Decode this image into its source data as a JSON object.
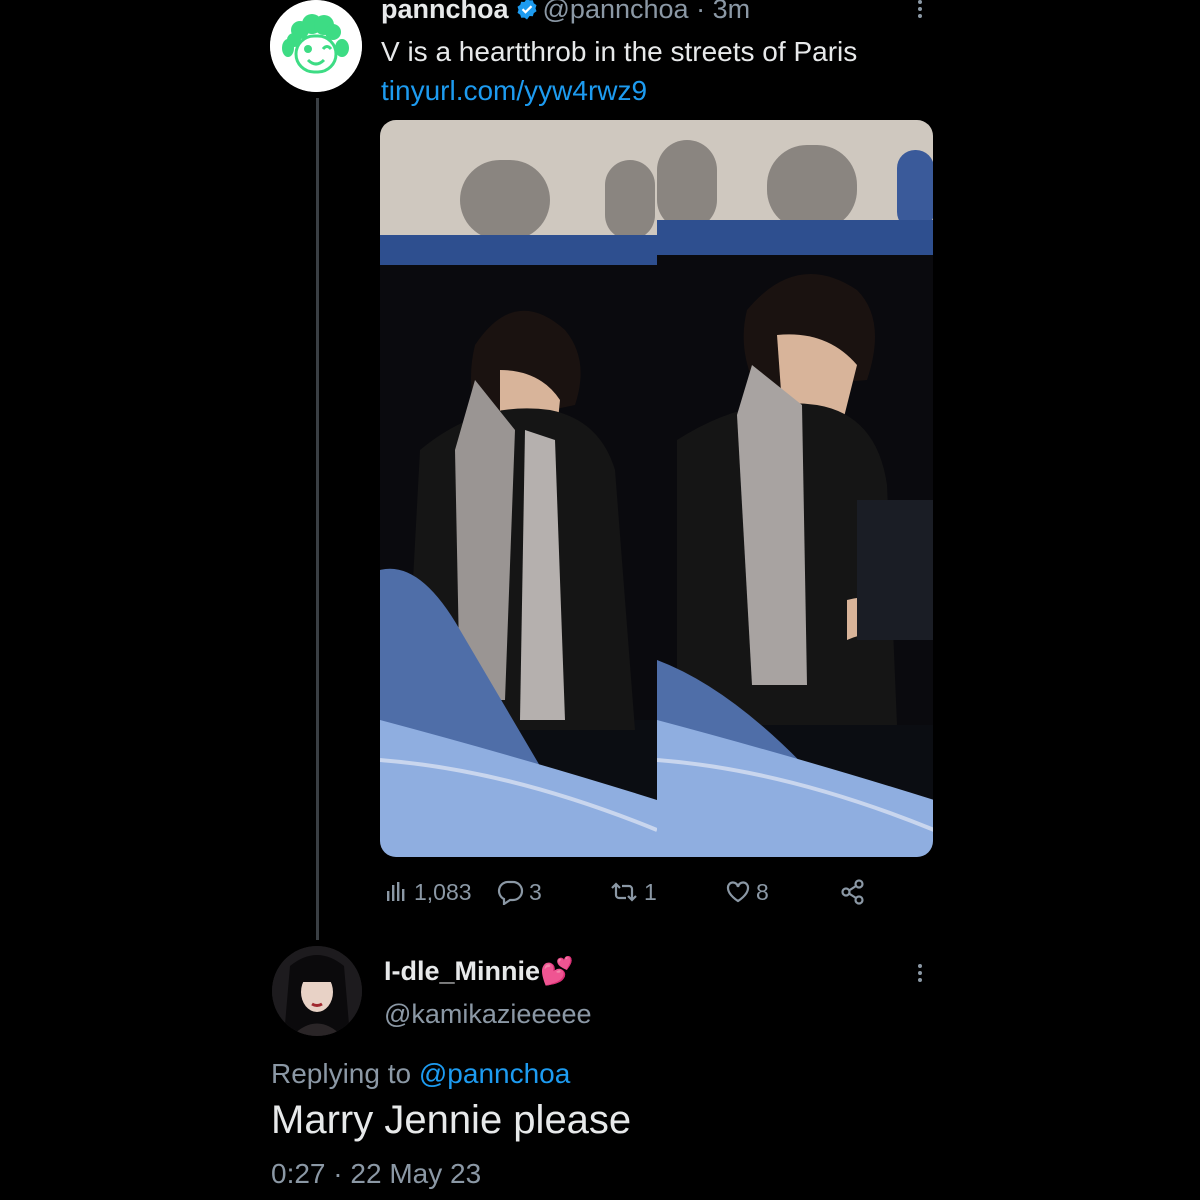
{
  "tweet": {
    "display_name": "pannchoa",
    "handle": "@pannchoa",
    "separator": "·",
    "time": "3m",
    "text": "V is a heartthrob in the streets of Paris",
    "link": "tinyurl.com/yyw4rwz9",
    "stats": {
      "views": "1,083",
      "replies": "3",
      "retweets": "1",
      "likes": "8"
    }
  },
  "reply": {
    "display_name": "I-dle_Minnie",
    "name_emoji": "💕",
    "handle": "@kamikazieeeee",
    "replying_prefix": "Replying to",
    "replying_to": "@pannchoa",
    "text": "Marry Jennie please",
    "time": "0:27",
    "separator": "·",
    "date": "22 May 23"
  },
  "colors": {
    "accent": "#1d9bf0",
    "muted": "#8b98a5",
    "avatar_green": "#3ddc84"
  }
}
